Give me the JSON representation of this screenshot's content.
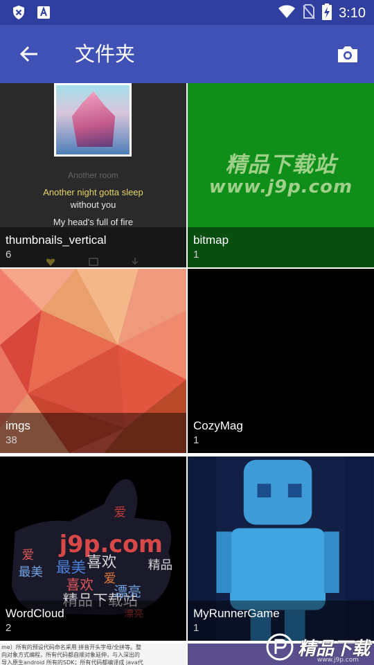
{
  "status_bar": {
    "time": "3:10"
  },
  "app_bar": {
    "title": "文件夹"
  },
  "folders": [
    {
      "name": "thumbnails_vertical",
      "count": "6"
    },
    {
      "name": "bitmap",
      "count": "1"
    },
    {
      "name": "imgs",
      "count": "38"
    },
    {
      "name": "CozyMag",
      "count": "1"
    },
    {
      "name": "WordCloud",
      "count": "2"
    },
    {
      "name": "MyRunnerGame",
      "count": "1"
    }
  ],
  "music_thumb": {
    "line1": "Another room",
    "line2": "Another night gotta sleep",
    "line3": "without you",
    "line4": "My head's full of fire"
  },
  "bitmap_thumb": {
    "watermark_cn": "精品下载站",
    "watermark_url": "www.j9p.com"
  },
  "doc_thumb": {
    "line1": "me）所有的预设代码命名采用 拼音开头字母/全拼等。整",
    "line2": "向对象方式编程，所有代码都自顺对象延伸，与入深出的",
    "line3": "导入原生android 所有的SDK；所有代码都编译成 java代"
  },
  "site_watermark": {
    "text": "精品下载",
    "sub": "www.j9p.com"
  },
  "colors": {
    "status_bar": "#303f9f",
    "app_bar": "#3f51b5"
  }
}
